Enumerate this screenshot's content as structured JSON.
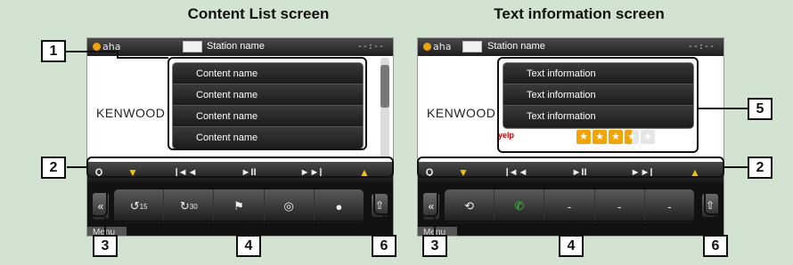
{
  "titles": {
    "left": "Content List screen",
    "right": "Text information screen"
  },
  "left_screen": {
    "header": {
      "app_name": "aha",
      "station": "Station name",
      "clock": "--:--"
    },
    "brand": "KENWOOD",
    "content_list": [
      "Content name",
      "Content name",
      "Content name",
      "Content name"
    ],
    "controls": {
      "search": "Q",
      "prev": "|◄◄",
      "play_pause": "►II",
      "next": "►►|"
    },
    "functions": [
      "15",
      "30",
      "",
      "",
      ""
    ],
    "menu_label": "Menu"
  },
  "right_screen": {
    "header": {
      "app_name": "aha",
      "station": "Station name",
      "clock": "--:--"
    },
    "brand": "KENWOOD",
    "text_info": [
      "Text information",
      "Text information",
      "Text information"
    ],
    "rating_source": "yelp",
    "rating": 3.5,
    "controls": {
      "search": "Q",
      "prev": "|◄◄",
      "play_pause": "►II",
      "next": "►►|"
    },
    "functions": [
      "",
      "",
      "-",
      "-",
      "-"
    ],
    "menu_label": "Menu"
  },
  "callouts": {
    "one": "1",
    "two_left": "2",
    "two_right": "2",
    "three_left": "3",
    "three_right": "3",
    "four_left": "4",
    "four_right": "4",
    "five": "5",
    "six_left": "6",
    "six_right": "6"
  },
  "colors": {
    "background": "#d3e3d1",
    "thumbs": "#f4c400",
    "stars": "#f4a400",
    "aha_dot": "#f2a200"
  }
}
